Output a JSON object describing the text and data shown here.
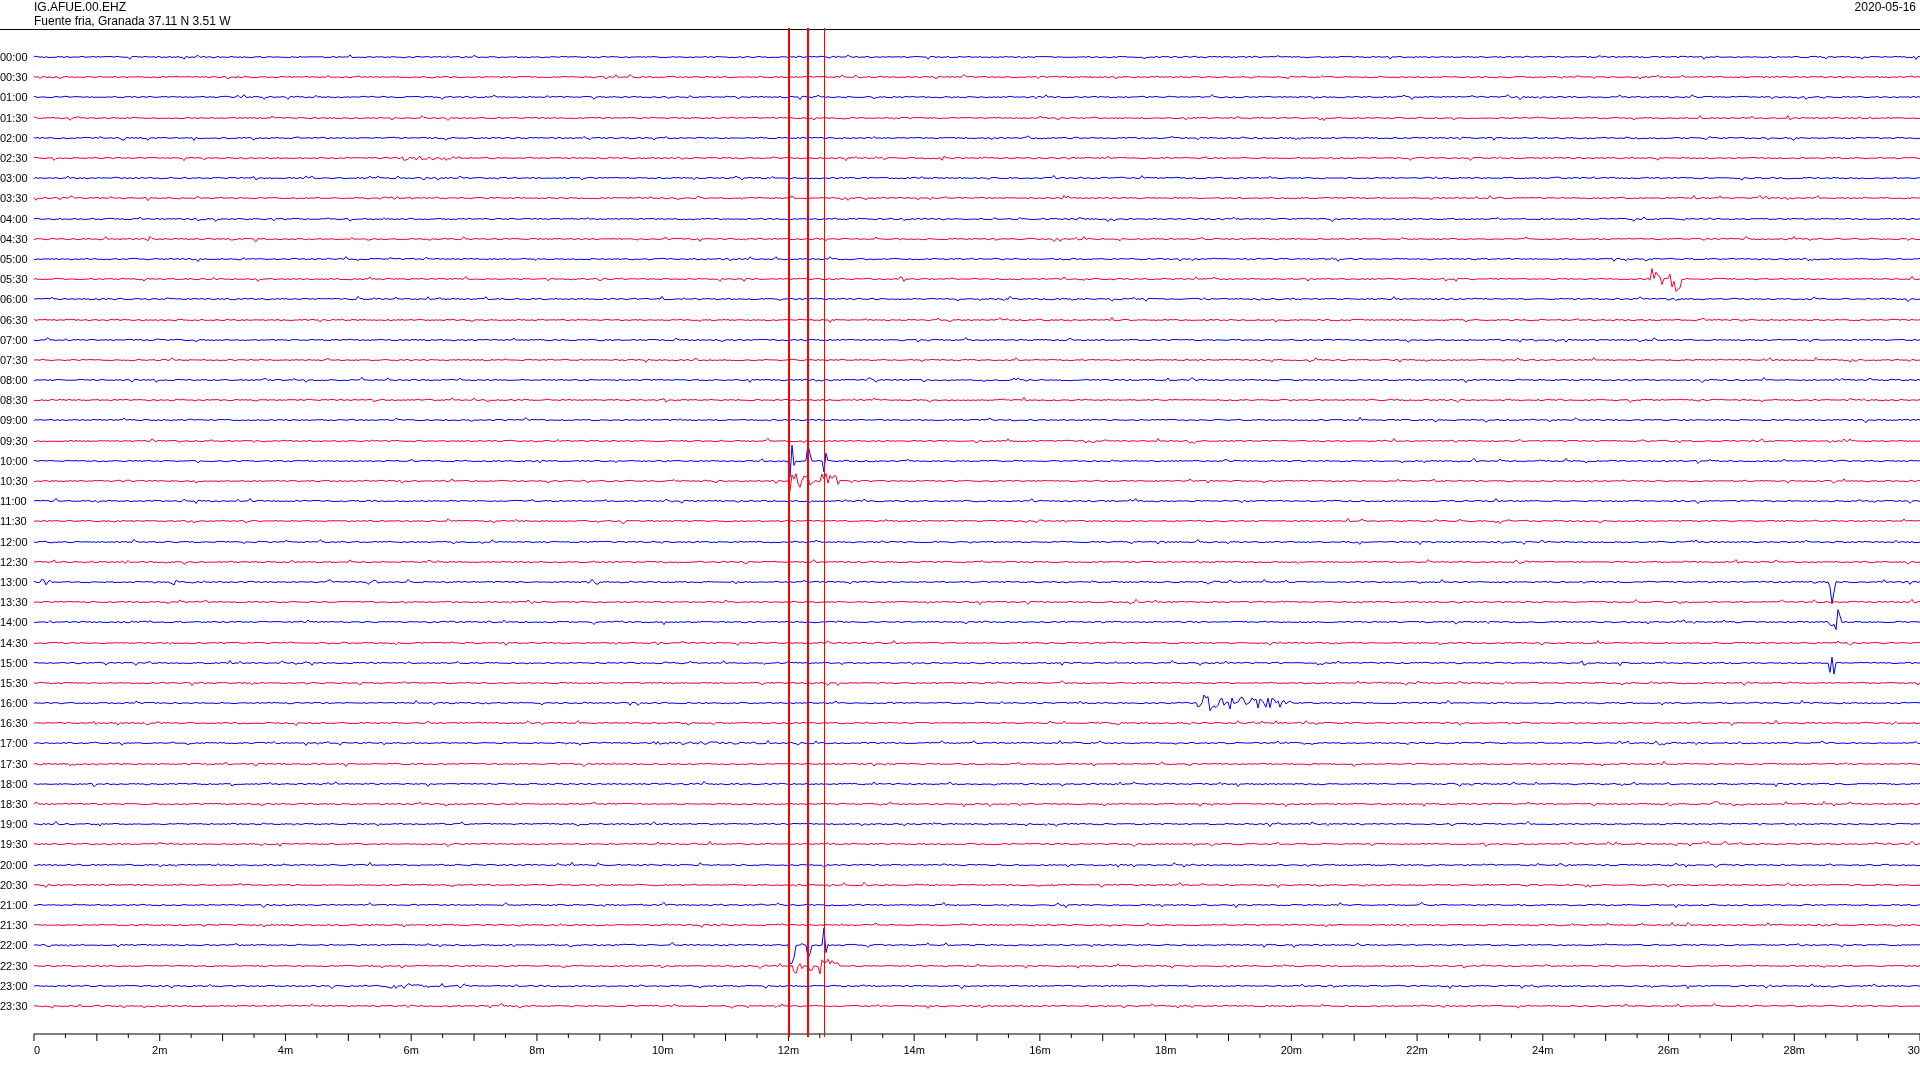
{
  "header": {
    "station": "IG.AFUE.00.EHZ",
    "location": "Fuente fria, Granada  37.11 N 3.51 W",
    "date": "2020-05-16"
  },
  "rows": [
    {
      "label": "00:00",
      "color": "#0000ff"
    },
    {
      "label": "00:30",
      "color": "#ff0033"
    },
    {
      "label": "01:00",
      "color": "#0000ff"
    },
    {
      "label": "01:30",
      "color": "#ff0033"
    },
    {
      "label": "02:00",
      "color": "#0000ff"
    },
    {
      "label": "02:30",
      "color": "#ff0033"
    },
    {
      "label": "03:00",
      "color": "#0000ff"
    },
    {
      "label": "03:30",
      "color": "#ff0033"
    },
    {
      "label": "04:00",
      "color": "#0000ff"
    },
    {
      "label": "04:30",
      "color": "#ff0033"
    },
    {
      "label": "05:00",
      "color": "#0000ff"
    },
    {
      "label": "05:30",
      "color": "#ff0033"
    },
    {
      "label": "06:00",
      "color": "#0000ff"
    },
    {
      "label": "06:30",
      "color": "#ff0033"
    },
    {
      "label": "07:00",
      "color": "#0000ff"
    },
    {
      "label": "07:30",
      "color": "#ff0033"
    },
    {
      "label": "08:00",
      "color": "#0000ff"
    },
    {
      "label": "08:30",
      "color": "#ff0033"
    },
    {
      "label": "09:00",
      "color": "#0000ff"
    },
    {
      "label": "09:30",
      "color": "#ff0033"
    },
    {
      "label": "10:00",
      "color": "#0000ff"
    },
    {
      "label": "10:30",
      "color": "#ff0033"
    },
    {
      "label": "11:00",
      "color": "#0000ff"
    },
    {
      "label": "11:30",
      "color": "#ff0033"
    },
    {
      "label": "12:00",
      "color": "#0000ff"
    },
    {
      "label": "12:30",
      "color": "#ff0033"
    },
    {
      "label": "13:00",
      "color": "#0000ff"
    },
    {
      "label": "13:30",
      "color": "#ff0033"
    },
    {
      "label": "14:00",
      "color": "#0000ff"
    },
    {
      "label": "14:30",
      "color": "#ff0033"
    },
    {
      "label": "15:00",
      "color": "#0000ff"
    },
    {
      "label": "15:30",
      "color": "#ff0033"
    },
    {
      "label": "16:00",
      "color": "#0000ff"
    },
    {
      "label": "16:30",
      "color": "#ff0033"
    },
    {
      "label": "17:00",
      "color": "#0000ff"
    },
    {
      "label": "17:30",
      "color": "#ff0033"
    },
    {
      "label": "18:00",
      "color": "#0000ff"
    },
    {
      "label": "18:30",
      "color": "#ff0033"
    },
    {
      "label": "19:00",
      "color": "#0000ff"
    },
    {
      "label": "19:30",
      "color": "#ff0033"
    },
    {
      "label": "20:00",
      "color": "#0000ff"
    },
    {
      "label": "20:30",
      "color": "#ff0033"
    },
    {
      "label": "21:00",
      "color": "#0000ff"
    },
    {
      "label": "21:30",
      "color": "#ff0033"
    },
    {
      "label": "22:00",
      "color": "#0000ff"
    },
    {
      "label": "22:30",
      "color": "#ff0033"
    },
    {
      "label": "23:00",
      "color": "#0000ff"
    },
    {
      "label": "23:30",
      "color": "#ff0033"
    }
  ],
  "x_axis": {
    "tick_labels": [
      "0",
      "2m",
      "4m",
      "6m",
      "8m",
      "10m",
      "12m",
      "14m",
      "16m",
      "18m",
      "20m",
      "22m",
      "24m",
      "26m",
      "28m",
      "30"
    ]
  }
}
